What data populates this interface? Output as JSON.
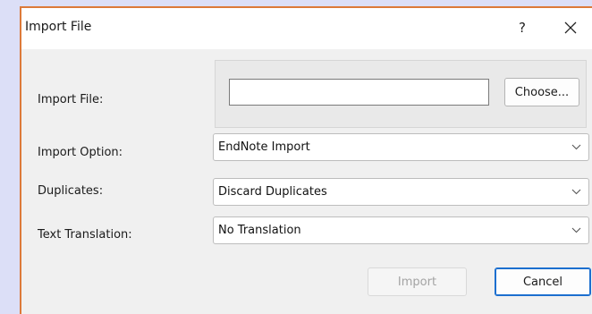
{
  "dialog": {
    "title": "Import File",
    "help_label": "?",
    "close_icon": "close-icon"
  },
  "fields": {
    "import_file_label": "Import File:",
    "import_file_value": "",
    "choose_label": "Choose...",
    "import_option_label": "Import Option:",
    "import_option_value": "EndNote Import",
    "duplicates_label": "Duplicates:",
    "duplicates_value": "Discard Duplicates",
    "text_translation_label": "Text Translation:",
    "text_translation_value": "No Translation"
  },
  "buttons": {
    "import_label": "Import",
    "cancel_label": "Cancel"
  },
  "colors": {
    "window_accent": "#dc7a3a",
    "default_button_border": "#1c6fcf",
    "disabled_text": "#a3a3a3"
  }
}
